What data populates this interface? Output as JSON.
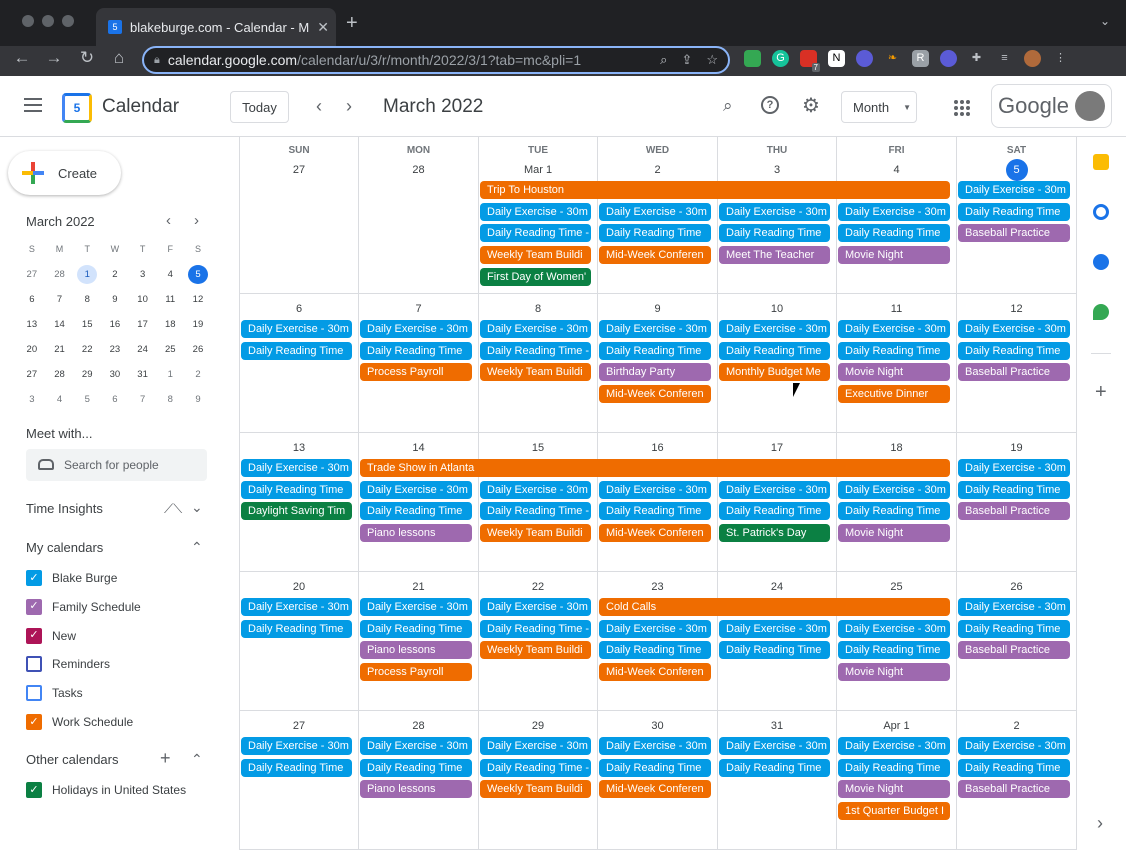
{
  "browser": {
    "tab_title": "blakeburge.com - Calendar - M",
    "favicon_text": "5",
    "url_host": "calendar.google.com",
    "url_path": "/calendar/u/3/r/month/2022/3/1?tab=mc&pli=1",
    "ext_badge": "7"
  },
  "header": {
    "app_title": "Calendar",
    "today_label": "Today",
    "month_title": "March 2022",
    "view_label": "Month",
    "google_label": "Google"
  },
  "sidebar": {
    "create_label": "Create",
    "mini_title": "March 2022",
    "mini_days": [
      "S",
      "M",
      "T",
      "W",
      "T",
      "F",
      "S"
    ],
    "mini_dates": [
      "27",
      "28",
      "1",
      "2",
      "3",
      "4",
      "5",
      "6",
      "7",
      "8",
      "9",
      "10",
      "11",
      "12",
      "13",
      "14",
      "15",
      "16",
      "17",
      "18",
      "19",
      "20",
      "21",
      "22",
      "23",
      "24",
      "25",
      "26",
      "27",
      "28",
      "29",
      "30",
      "31",
      "1",
      "2",
      "3",
      "4",
      "5",
      "6",
      "7",
      "8",
      "9"
    ],
    "meet_label": "Meet with...",
    "search_people": "Search for people",
    "time_insights": "Time Insights",
    "my_calendars": "My calendars",
    "calendars": [
      {
        "name": "Blake Burge",
        "color": "#039be5",
        "checked": true
      },
      {
        "name": "Family Schedule",
        "color": "#9e69af",
        "checked": true
      },
      {
        "name": "New",
        "color": "#ad1457",
        "checked": true
      },
      {
        "name": "Reminders",
        "color": "#3f51b5",
        "checked": false
      },
      {
        "name": "Tasks",
        "color": "#4285f4",
        "checked": false
      },
      {
        "name": "Work Schedule",
        "color": "#ef6c00",
        "checked": true
      }
    ],
    "other_calendars": "Other calendars",
    "other": [
      {
        "name": "Holidays in United States",
        "color": "#0b8043",
        "checked": true
      }
    ]
  },
  "colors": {
    "blue": "#039be5",
    "orange": "#ef6c00",
    "purple": "#9e69af",
    "green": "#0b8043"
  },
  "grid": {
    "weekdays": [
      "SUN",
      "MON",
      "TUE",
      "WED",
      "THU",
      "FRI",
      "SAT"
    ],
    "weeks": [
      [
        "27",
        "28",
        "Mar 1",
        "2",
        "3",
        "4",
        "5"
      ],
      [
        "6",
        "7",
        "8",
        "9",
        "10",
        "11",
        "12"
      ],
      [
        "13",
        "14",
        "15",
        "16",
        "17",
        "18",
        "19"
      ],
      [
        "20",
        "21",
        "22",
        "23",
        "24",
        "25",
        "26"
      ],
      [
        "27",
        "28",
        "29",
        "30",
        "31",
        "Apr 1",
        "2"
      ]
    ],
    "today": {
      "week": 0,
      "day": 6
    },
    "events": [
      {
        "w": 0,
        "d": 2,
        "span": 4,
        "slot": 0,
        "c": "orange",
        "t": "Trip To Houston"
      },
      {
        "w": 0,
        "d": 6,
        "span": 1,
        "slot": 0,
        "c": "blue",
        "t": "Daily Exercise - 30m"
      },
      {
        "w": 0,
        "d": 2,
        "span": 1,
        "slot": 1,
        "c": "blue",
        "t": "Daily Exercise - 30m"
      },
      {
        "w": 0,
        "d": 3,
        "span": 1,
        "slot": 1,
        "c": "blue",
        "t": "Daily Exercise - 30m"
      },
      {
        "w": 0,
        "d": 4,
        "span": 1,
        "slot": 1,
        "c": "blue",
        "t": "Daily Exercise - 30m"
      },
      {
        "w": 0,
        "d": 5,
        "span": 1,
        "slot": 1,
        "c": "blue",
        "t": "Daily Exercise - 30m"
      },
      {
        "w": 0,
        "d": 6,
        "span": 1,
        "slot": 1,
        "c": "blue",
        "t": "Daily Reading Time"
      },
      {
        "w": 0,
        "d": 2,
        "span": 1,
        "slot": 2,
        "c": "blue",
        "t": "Daily Reading Time -"
      },
      {
        "w": 0,
        "d": 3,
        "span": 1,
        "slot": 2,
        "c": "blue",
        "t": "Daily Reading Time"
      },
      {
        "w": 0,
        "d": 4,
        "span": 1,
        "slot": 2,
        "c": "blue",
        "t": "Daily Reading Time"
      },
      {
        "w": 0,
        "d": 5,
        "span": 1,
        "slot": 2,
        "c": "blue",
        "t": "Daily Reading Time"
      },
      {
        "w": 0,
        "d": 6,
        "span": 1,
        "slot": 2,
        "c": "purple",
        "t": "Baseball Practice"
      },
      {
        "w": 0,
        "d": 2,
        "span": 1,
        "slot": 3,
        "c": "orange",
        "t": "Weekly Team Buildi"
      },
      {
        "w": 0,
        "d": 3,
        "span": 1,
        "slot": 3,
        "c": "orange",
        "t": "Mid-Week Conferen"
      },
      {
        "w": 0,
        "d": 4,
        "span": 1,
        "slot": 3,
        "c": "purple",
        "t": "Meet The Teacher"
      },
      {
        "w": 0,
        "d": 5,
        "span": 1,
        "slot": 3,
        "c": "purple",
        "t": "Movie Night"
      },
      {
        "w": 0,
        "d": 2,
        "span": 1,
        "slot": 4,
        "c": "green",
        "t": "First Day of Women'"
      },
      {
        "w": 1,
        "d": 0,
        "span": 1,
        "slot": 0,
        "c": "blue",
        "t": "Daily Exercise - 30m"
      },
      {
        "w": 1,
        "d": 1,
        "span": 1,
        "slot": 0,
        "c": "blue",
        "t": "Daily Exercise - 30m"
      },
      {
        "w": 1,
        "d": 2,
        "span": 1,
        "slot": 0,
        "c": "blue",
        "t": "Daily Exercise - 30m"
      },
      {
        "w": 1,
        "d": 3,
        "span": 1,
        "slot": 0,
        "c": "blue",
        "t": "Daily Exercise - 30m"
      },
      {
        "w": 1,
        "d": 4,
        "span": 1,
        "slot": 0,
        "c": "blue",
        "t": "Daily Exercise - 30m"
      },
      {
        "w": 1,
        "d": 5,
        "span": 1,
        "slot": 0,
        "c": "blue",
        "t": "Daily Exercise - 30m"
      },
      {
        "w": 1,
        "d": 6,
        "span": 1,
        "slot": 0,
        "c": "blue",
        "t": "Daily Exercise - 30m"
      },
      {
        "w": 1,
        "d": 0,
        "span": 1,
        "slot": 1,
        "c": "blue",
        "t": "Daily Reading Time"
      },
      {
        "w": 1,
        "d": 1,
        "span": 1,
        "slot": 1,
        "c": "blue",
        "t": "Daily Reading Time"
      },
      {
        "w": 1,
        "d": 2,
        "span": 1,
        "slot": 1,
        "c": "blue",
        "t": "Daily Reading Time -"
      },
      {
        "w": 1,
        "d": 3,
        "span": 1,
        "slot": 1,
        "c": "blue",
        "t": "Daily Reading Time"
      },
      {
        "w": 1,
        "d": 4,
        "span": 1,
        "slot": 1,
        "c": "blue",
        "t": "Daily Reading Time"
      },
      {
        "w": 1,
        "d": 5,
        "span": 1,
        "slot": 1,
        "c": "blue",
        "t": "Daily Reading Time"
      },
      {
        "w": 1,
        "d": 6,
        "span": 1,
        "slot": 1,
        "c": "blue",
        "t": "Daily Reading Time"
      },
      {
        "w": 1,
        "d": 1,
        "span": 1,
        "slot": 2,
        "c": "orange",
        "t": "Process Payroll"
      },
      {
        "w": 1,
        "d": 2,
        "span": 1,
        "slot": 2,
        "c": "orange",
        "t": "Weekly Team Buildi"
      },
      {
        "w": 1,
        "d": 3,
        "span": 1,
        "slot": 2,
        "c": "purple",
        "t": "Birthday Party"
      },
      {
        "w": 1,
        "d": 4,
        "span": 1,
        "slot": 2,
        "c": "orange",
        "t": "Monthly Budget Me"
      },
      {
        "w": 1,
        "d": 5,
        "span": 1,
        "slot": 2,
        "c": "purple",
        "t": "Movie Night"
      },
      {
        "w": 1,
        "d": 6,
        "span": 1,
        "slot": 2,
        "c": "purple",
        "t": "Baseball Practice"
      },
      {
        "w": 1,
        "d": 3,
        "span": 1,
        "slot": 3,
        "c": "orange",
        "t": "Mid-Week Conferen"
      },
      {
        "w": 1,
        "d": 5,
        "span": 1,
        "slot": 3,
        "c": "orange",
        "t": "Executive Dinner"
      },
      {
        "w": 2,
        "d": 0,
        "span": 1,
        "slot": 0,
        "c": "blue",
        "t": "Daily Exercise - 30m"
      },
      {
        "w": 2,
        "d": 1,
        "span": 5,
        "slot": 0,
        "c": "orange",
        "t": "Trade Show in Atlanta"
      },
      {
        "w": 2,
        "d": 6,
        "span": 1,
        "slot": 0,
        "c": "blue",
        "t": "Daily Exercise - 30m"
      },
      {
        "w": 2,
        "d": 0,
        "span": 1,
        "slot": 1,
        "c": "blue",
        "t": "Daily Reading Time"
      },
      {
        "w": 2,
        "d": 1,
        "span": 1,
        "slot": 1,
        "c": "blue",
        "t": "Daily Exercise - 30m"
      },
      {
        "w": 2,
        "d": 2,
        "span": 1,
        "slot": 1,
        "c": "blue",
        "t": "Daily Exercise - 30m"
      },
      {
        "w": 2,
        "d": 3,
        "span": 1,
        "slot": 1,
        "c": "blue",
        "t": "Daily Exercise - 30m"
      },
      {
        "w": 2,
        "d": 4,
        "span": 1,
        "slot": 1,
        "c": "blue",
        "t": "Daily Exercise - 30m"
      },
      {
        "w": 2,
        "d": 5,
        "span": 1,
        "slot": 1,
        "c": "blue",
        "t": "Daily Exercise - 30m"
      },
      {
        "w": 2,
        "d": 6,
        "span": 1,
        "slot": 1,
        "c": "blue",
        "t": "Daily Reading Time"
      },
      {
        "w": 2,
        "d": 0,
        "span": 1,
        "slot": 2,
        "c": "green",
        "t": "Daylight Saving Tim"
      },
      {
        "w": 2,
        "d": 1,
        "span": 1,
        "slot": 2,
        "c": "blue",
        "t": "Daily Reading Time"
      },
      {
        "w": 2,
        "d": 2,
        "span": 1,
        "slot": 2,
        "c": "blue",
        "t": "Daily Reading Time -"
      },
      {
        "w": 2,
        "d": 3,
        "span": 1,
        "slot": 2,
        "c": "blue",
        "t": "Daily Reading Time"
      },
      {
        "w": 2,
        "d": 4,
        "span": 1,
        "slot": 2,
        "c": "blue",
        "t": "Daily Reading Time"
      },
      {
        "w": 2,
        "d": 5,
        "span": 1,
        "slot": 2,
        "c": "blue",
        "t": "Daily Reading Time"
      },
      {
        "w": 2,
        "d": 6,
        "span": 1,
        "slot": 2,
        "c": "purple",
        "t": "Baseball Practice"
      },
      {
        "w": 2,
        "d": 1,
        "span": 1,
        "slot": 3,
        "c": "purple",
        "t": "Piano lessons"
      },
      {
        "w": 2,
        "d": 2,
        "span": 1,
        "slot": 3,
        "c": "orange",
        "t": "Weekly Team Buildi"
      },
      {
        "w": 2,
        "d": 3,
        "span": 1,
        "slot": 3,
        "c": "orange",
        "t": "Mid-Week Conferen"
      },
      {
        "w": 2,
        "d": 4,
        "span": 1,
        "slot": 3,
        "c": "green",
        "t": "St. Patrick's Day"
      },
      {
        "w": 2,
        "d": 5,
        "span": 1,
        "slot": 3,
        "c": "purple",
        "t": "Movie Night"
      },
      {
        "w": 3,
        "d": 0,
        "span": 1,
        "slot": 0,
        "c": "blue",
        "t": "Daily Exercise - 30m"
      },
      {
        "w": 3,
        "d": 1,
        "span": 1,
        "slot": 0,
        "c": "blue",
        "t": "Daily Exercise - 30m"
      },
      {
        "w": 3,
        "d": 2,
        "span": 1,
        "slot": 0,
        "c": "blue",
        "t": "Daily Exercise - 30m"
      },
      {
        "w": 3,
        "d": 3,
        "span": 3,
        "slot": 0,
        "c": "orange",
        "t": "Cold Calls"
      },
      {
        "w": 3,
        "d": 6,
        "span": 1,
        "slot": 0,
        "c": "blue",
        "t": "Daily Exercise - 30m"
      },
      {
        "w": 3,
        "d": 0,
        "span": 1,
        "slot": 1,
        "c": "blue",
        "t": "Daily Reading Time"
      },
      {
        "w": 3,
        "d": 1,
        "span": 1,
        "slot": 1,
        "c": "blue",
        "t": "Daily Reading Time"
      },
      {
        "w": 3,
        "d": 2,
        "span": 1,
        "slot": 1,
        "c": "blue",
        "t": "Daily Reading Time -"
      },
      {
        "w": 3,
        "d": 3,
        "span": 1,
        "slot": 1,
        "c": "blue",
        "t": "Daily Exercise - 30m"
      },
      {
        "w": 3,
        "d": 4,
        "span": 1,
        "slot": 1,
        "c": "blue",
        "t": "Daily Exercise - 30m"
      },
      {
        "w": 3,
        "d": 5,
        "span": 1,
        "slot": 1,
        "c": "blue",
        "t": "Daily Exercise - 30m"
      },
      {
        "w": 3,
        "d": 6,
        "span": 1,
        "slot": 1,
        "c": "blue",
        "t": "Daily Reading Time"
      },
      {
        "w": 3,
        "d": 1,
        "span": 1,
        "slot": 2,
        "c": "purple",
        "t": "Piano lessons"
      },
      {
        "w": 3,
        "d": 2,
        "span": 1,
        "slot": 2,
        "c": "orange",
        "t": "Weekly Team Buildi"
      },
      {
        "w": 3,
        "d": 3,
        "span": 1,
        "slot": 2,
        "c": "blue",
        "t": "Daily Reading Time"
      },
      {
        "w": 3,
        "d": 4,
        "span": 1,
        "slot": 2,
        "c": "blue",
        "t": "Daily Reading Time"
      },
      {
        "w": 3,
        "d": 5,
        "span": 1,
        "slot": 2,
        "c": "blue",
        "t": "Daily Reading Time"
      },
      {
        "w": 3,
        "d": 6,
        "span": 1,
        "slot": 2,
        "c": "purple",
        "t": "Baseball Practice"
      },
      {
        "w": 3,
        "d": 1,
        "span": 1,
        "slot": 3,
        "c": "orange",
        "t": "Process Payroll"
      },
      {
        "w": 3,
        "d": 3,
        "span": 1,
        "slot": 3,
        "c": "orange",
        "t": "Mid-Week Conferen"
      },
      {
        "w": 3,
        "d": 5,
        "span": 1,
        "slot": 3,
        "c": "purple",
        "t": "Movie Night"
      },
      {
        "w": 4,
        "d": 0,
        "span": 1,
        "slot": 0,
        "c": "blue",
        "t": "Daily Exercise - 30m"
      },
      {
        "w": 4,
        "d": 1,
        "span": 1,
        "slot": 0,
        "c": "blue",
        "t": "Daily Exercise - 30m"
      },
      {
        "w": 4,
        "d": 2,
        "span": 1,
        "slot": 0,
        "c": "blue",
        "t": "Daily Exercise - 30m"
      },
      {
        "w": 4,
        "d": 3,
        "span": 1,
        "slot": 0,
        "c": "blue",
        "t": "Daily Exercise - 30m"
      },
      {
        "w": 4,
        "d": 4,
        "span": 1,
        "slot": 0,
        "c": "blue",
        "t": "Daily Exercise - 30m"
      },
      {
        "w": 4,
        "d": 5,
        "span": 1,
        "slot": 0,
        "c": "blue",
        "t": "Daily Exercise - 30m"
      },
      {
        "w": 4,
        "d": 6,
        "span": 1,
        "slot": 0,
        "c": "blue",
        "t": "Daily Exercise - 30m"
      },
      {
        "w": 4,
        "d": 0,
        "span": 1,
        "slot": 1,
        "c": "blue",
        "t": "Daily Reading Time"
      },
      {
        "w": 4,
        "d": 1,
        "span": 1,
        "slot": 1,
        "c": "blue",
        "t": "Daily Reading Time"
      },
      {
        "w": 4,
        "d": 2,
        "span": 1,
        "slot": 1,
        "c": "blue",
        "t": "Daily Reading Time -"
      },
      {
        "w": 4,
        "d": 3,
        "span": 1,
        "slot": 1,
        "c": "blue",
        "t": "Daily Reading Time"
      },
      {
        "w": 4,
        "d": 4,
        "span": 1,
        "slot": 1,
        "c": "blue",
        "t": "Daily Reading Time"
      },
      {
        "w": 4,
        "d": 5,
        "span": 1,
        "slot": 1,
        "c": "blue",
        "t": "Daily Reading Time"
      },
      {
        "w": 4,
        "d": 6,
        "span": 1,
        "slot": 1,
        "c": "blue",
        "t": "Daily Reading Time"
      },
      {
        "w": 4,
        "d": 1,
        "span": 1,
        "slot": 2,
        "c": "purple",
        "t": "Piano lessons"
      },
      {
        "w": 4,
        "d": 2,
        "span": 1,
        "slot": 2,
        "c": "orange",
        "t": "Weekly Team Buildi"
      },
      {
        "w": 4,
        "d": 3,
        "span": 1,
        "slot": 2,
        "c": "orange",
        "t": "Mid-Week Conferen"
      },
      {
        "w": 4,
        "d": 5,
        "span": 1,
        "slot": 2,
        "c": "purple",
        "t": "Movie Night"
      },
      {
        "w": 4,
        "d": 6,
        "span": 1,
        "slot": 2,
        "c": "purple",
        "t": "Baseball Practice"
      },
      {
        "w": 4,
        "d": 5,
        "span": 1,
        "slot": 3,
        "c": "orange",
        "t": "1st Quarter Budget I"
      }
    ]
  }
}
